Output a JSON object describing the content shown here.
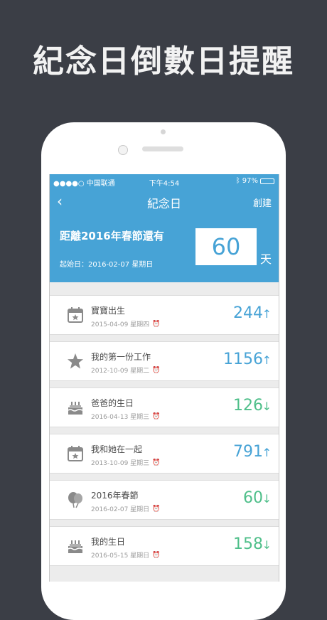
{
  "headline": "紀念日倒數日提醒",
  "status": {
    "carrier": "●●●●○ 中国联通",
    "time": "下午4:54",
    "battery": "97%"
  },
  "nav": {
    "back": "‹",
    "title": "紀念日",
    "create": "創建"
  },
  "hero": {
    "title": "距離2016年春節還有",
    "start": "起始日：2016-02-07 星期日",
    "count": "60",
    "unit": "天"
  },
  "colors": {
    "blue": "#47a3d6",
    "green": "#4fbf8a",
    "gray_icon": "#8a8a8a"
  },
  "items": [
    {
      "icon": "calendar-star-icon",
      "name": "寶寶出生",
      "date": "2015-04-09 星期四",
      "days": "244",
      "arrow": "↑",
      "color": "#47a3d6"
    },
    {
      "icon": "star-icon",
      "name": "我的第一份工作",
      "date": "2012-10-09 星期二",
      "days": "1156",
      "arrow": "↑",
      "color": "#47a3d6"
    },
    {
      "icon": "cake-icon",
      "name": "爸爸的生日",
      "date": "2016-04-13 星期三",
      "days": "126",
      "arrow": "↓",
      "color": "#4fbf8a"
    },
    {
      "icon": "calendar-star-icon",
      "name": "我和她在一起",
      "date": "2013-10-09 星期三",
      "days": "791",
      "arrow": "↑",
      "color": "#47a3d6"
    },
    {
      "icon": "balloon-icon",
      "name": "2016年春節",
      "date": "2016-02-07 星期日",
      "days": "60",
      "arrow": "↓",
      "color": "#4fbf8a"
    },
    {
      "icon": "cake-icon",
      "name": "我的生日",
      "date": "2016-05-15 星期日",
      "days": "158",
      "arrow": "↓",
      "color": "#4fbf8a"
    }
  ]
}
